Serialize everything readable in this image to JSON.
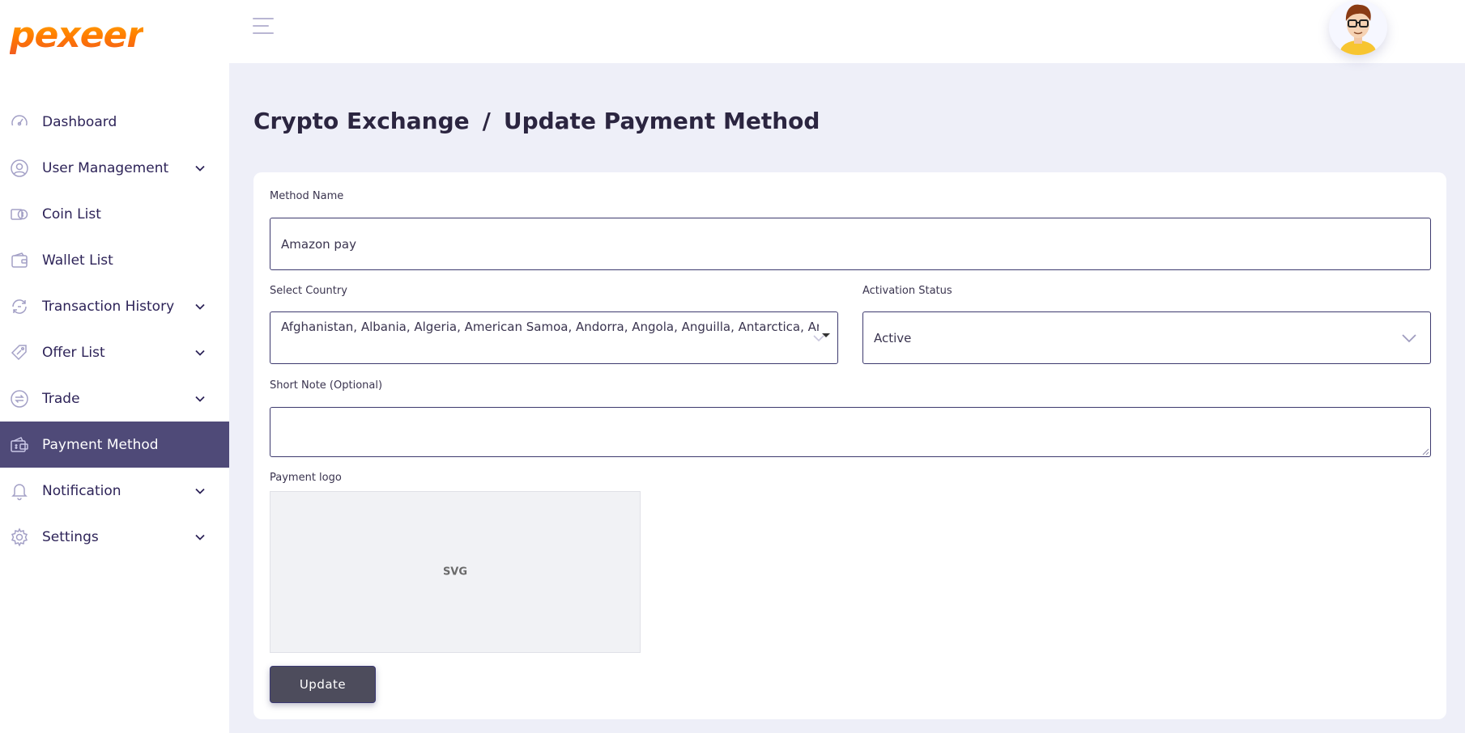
{
  "brand": {
    "name": "pexeer"
  },
  "sidebar": {
    "items": [
      {
        "label": "Dashboard",
        "icon": "speedometer-icon",
        "has_submenu": false,
        "active": false
      },
      {
        "label": "User Management",
        "icon": "user-circle-icon",
        "has_submenu": true,
        "active": false
      },
      {
        "label": "Coin List",
        "icon": "coins-icon",
        "has_submenu": false,
        "active": false
      },
      {
        "label": "Wallet List",
        "icon": "wallet-icon",
        "has_submenu": false,
        "active": false
      },
      {
        "label": "Transaction History",
        "icon": "transaction-history-icon",
        "has_submenu": true,
        "active": false
      },
      {
        "label": "Offer List",
        "icon": "price-tag-icon",
        "has_submenu": true,
        "active": false
      },
      {
        "label": "Trade",
        "icon": "exchange-arrows-icon",
        "has_submenu": true,
        "active": false
      },
      {
        "label": "Payment Method",
        "icon": "payment-wallet-icon",
        "has_submenu": false,
        "active": true
      },
      {
        "label": "Notification",
        "icon": "bell-icon",
        "has_submenu": true,
        "active": false
      },
      {
        "label": "Settings",
        "icon": "gear-icon",
        "has_submenu": true,
        "active": false
      }
    ]
  },
  "header": {
    "menu_icon": "hamburger-icon",
    "avatar_icon": "user-avatar-icon"
  },
  "page": {
    "breadcrumb_parent": "Crypto Exchange",
    "breadcrumb_separator": "/",
    "breadcrumb_current": "Update Payment Method"
  },
  "form": {
    "method_name_label": "Method Name",
    "method_name_value": "Amazon pay",
    "country_label": "Select Country",
    "country_value": "Afghanistan, Albania, Algeria, American Samoa, Andorra, Angola, Anguilla, Antarctica, Antigua",
    "status_label": "Activation Status",
    "status_value": "Active",
    "note_label": "Short Note (Optional)",
    "note_value": "",
    "logo_label": "Payment logo",
    "logo_placeholder": "SVG",
    "submit_label": "Update"
  },
  "colors": {
    "brand_gradient_start": "#ffb000",
    "brand_gradient_end": "#f15a22",
    "active_nav": "#4f4a78",
    "nav_text": "#2d2358",
    "input_border": "#3d3a6e",
    "background": "#eeeff8",
    "button": "#4d4c5c"
  }
}
